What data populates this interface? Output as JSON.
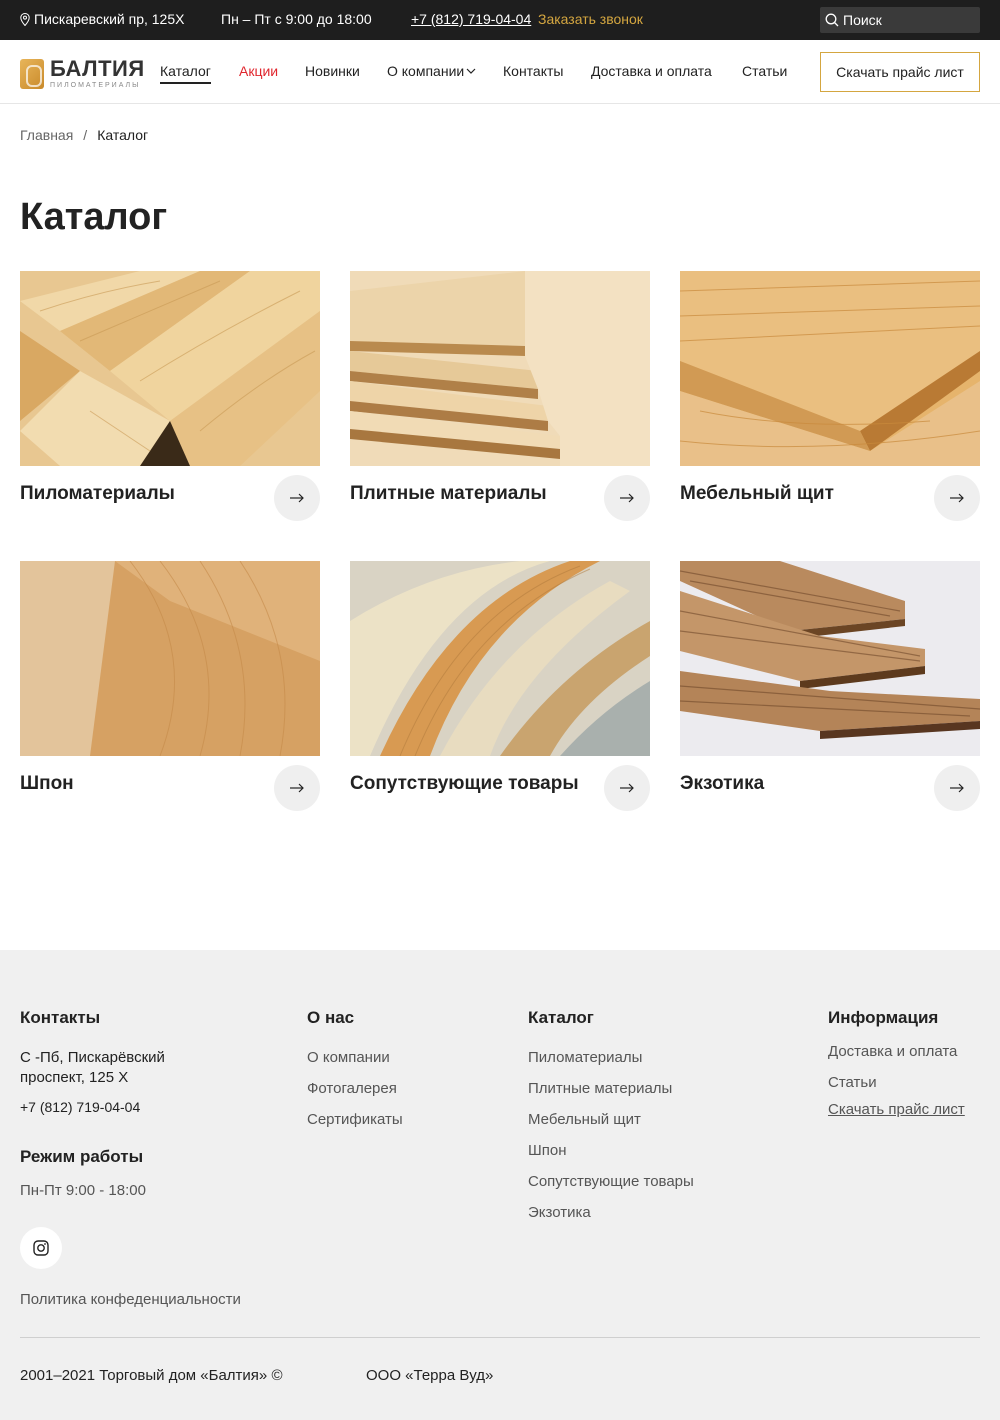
{
  "topbar": {
    "address": "Пискаревский пр, 125Х",
    "hours": "Пн – Пт с 9:00 до 18:00",
    "phone": "+7 (812) 719-04-04",
    "callback": "Заказать звонок",
    "search_placeholder": "Поиск"
  },
  "header": {
    "logo_name": "БАЛТИЯ",
    "logo_sub": "ПИЛОМАТЕРИАЛЫ",
    "nav": [
      {
        "label": "Каталог"
      },
      {
        "label": "Акции"
      },
      {
        "label": "Новинки"
      },
      {
        "label": "О компании"
      },
      {
        "label": "Контакты"
      },
      {
        "label": "Доставка и оплата"
      },
      {
        "label": "Статьи"
      }
    ],
    "price_button": "Скачать прайс лист"
  },
  "breadcrumb": {
    "home": "Главная",
    "separator": "/",
    "current": "Каталог"
  },
  "page_title": "Каталог",
  "catalog": [
    {
      "title": "Пиломатериалы"
    },
    {
      "title": "Плитные материалы"
    },
    {
      "title": "Мебельный щит"
    },
    {
      "title": "Шпон"
    },
    {
      "title": "Сопутствующие товары"
    },
    {
      "title": "Экзотика"
    }
  ],
  "footer": {
    "contacts": {
      "heading": "Контакты",
      "address_line1": "С -Пб, Пискарёвский",
      "address_line2": "проспект, 125 Х",
      "phone": "+7 (812) 719-04-04",
      "hours_heading": "Режим работы",
      "hours": "Пн-Пт  9:00 - 18:00"
    },
    "about": {
      "heading": "О нас",
      "links": [
        "О компании",
        "Фотогалерея",
        "Сертификаты"
      ]
    },
    "catalog": {
      "heading": "Каталог",
      "links": [
        "Пиломатериалы",
        "Плитные материалы",
        "Мебельный щит",
        "Шпон",
        "Сопутствующие товары",
        "Экзотика"
      ]
    },
    "info": {
      "heading": "Информация",
      "links": [
        "Доставка и оплата",
        "Статьи",
        "Скачать прайс лист"
      ]
    },
    "privacy": "Политика конфеденциальности",
    "copyright": "2001–2021 Торговый дом «Балтия» ©",
    "company": "ООО «Терра Вуд»"
  },
  "colors": {
    "topbar_bg": "#1e1e1e",
    "accent_gold": "#d4a640",
    "accent_red": "#e0262e",
    "footer_bg": "#f0f0f0"
  },
  "icons": [
    "map-pin-icon",
    "search-icon",
    "chevron-down-icon",
    "arrow-right-icon",
    "instagram-icon"
  ]
}
